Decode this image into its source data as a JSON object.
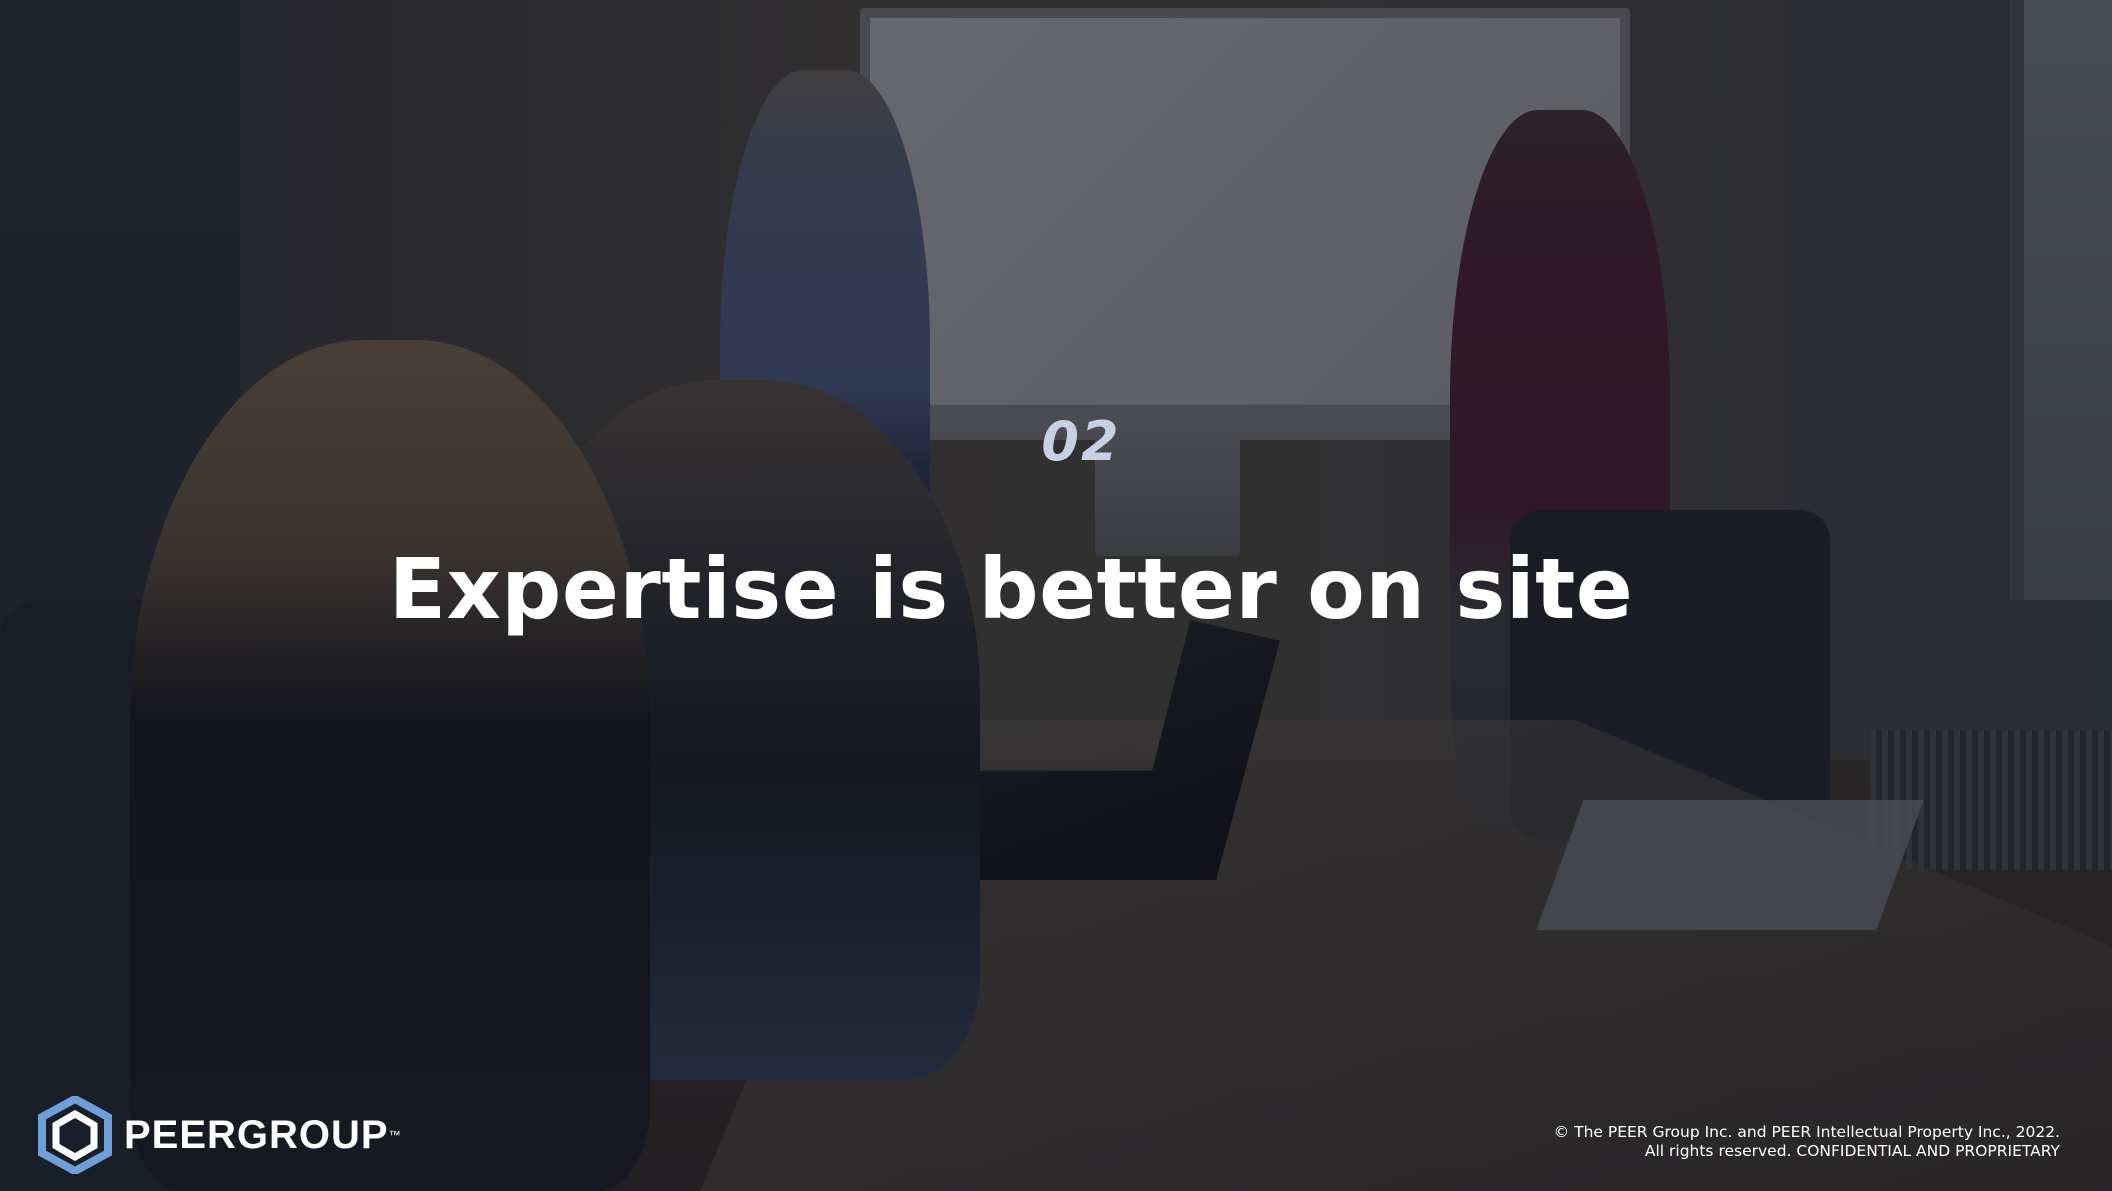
{
  "slide": {
    "section_number": "02",
    "headline": "Expertise is better on site",
    "logo": {
      "name": "PEERGROUP",
      "tm": "™"
    },
    "copyright": {
      "line1": "© The PEER Group Inc. and PEER Intellectual Property Inc., 2022.",
      "line2": "All rights reserved. CONFIDENTIAL AND PROPRIETARY"
    }
  },
  "colors": {
    "overlay": "#0c101c",
    "section_number": "#c8d0e6",
    "headline": "#ffffff",
    "logo_blue": "#6f9fd8"
  },
  "icons": {
    "logo_mark": "hexagon-logo-icon"
  }
}
